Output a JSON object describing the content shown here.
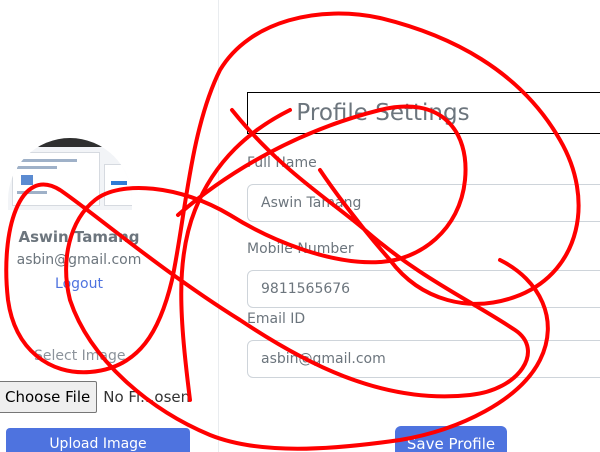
{
  "sidebar": {
    "user_name": "Aswin Tamang",
    "user_email": "asbin@gmail.com",
    "logout_label": "Logout",
    "select_image_label": "Select Image",
    "choose_file_label": "Choose File",
    "file_status": "No Fi...osen",
    "upload_label": "Upload Image"
  },
  "profile": {
    "title": "Profile Settings",
    "full_name_label": "Full Name",
    "full_name_value": "Aswin Tamang",
    "mobile_label": "Mobile Number",
    "mobile_value": "9811565676",
    "email_label": "Email ID",
    "email_value": "asbin@gmail.com",
    "save_label": "Save Profile"
  },
  "colors": {
    "primary": "#4e73df",
    "scribble": "#ff0000",
    "muted_text": "#6c757d"
  }
}
